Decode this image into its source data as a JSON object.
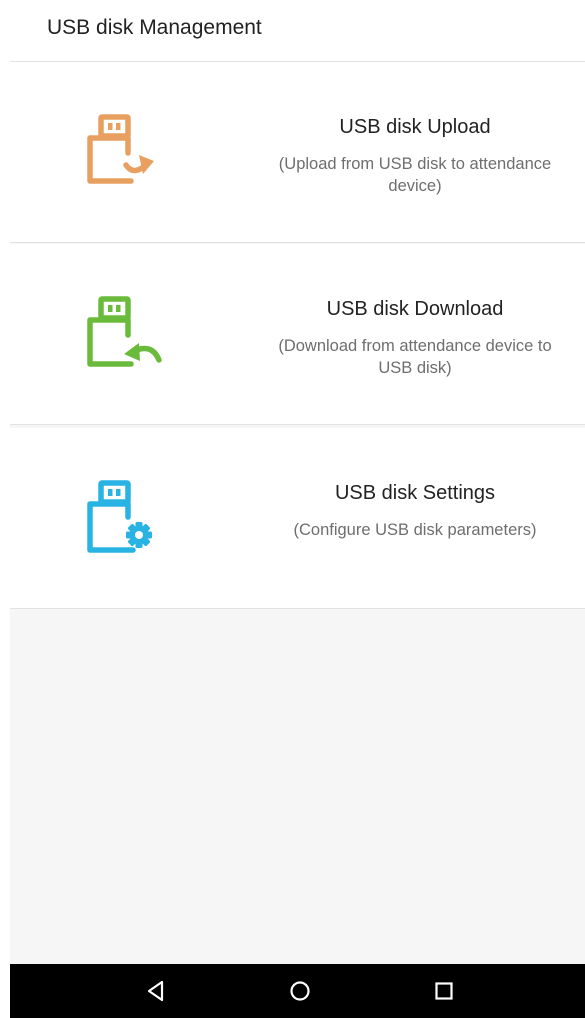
{
  "header": {
    "title": "USB disk Management"
  },
  "menu": {
    "items": [
      {
        "title": "USB disk Upload",
        "subtitle": "(Upload from USB disk to attendance device)",
        "icon": "usb-upload-icon",
        "color": "#e8a060"
      },
      {
        "title": "USB disk Download",
        "subtitle": "(Download from attendance device to USB disk)",
        "icon": "usb-download-icon",
        "color": "#6abb3c"
      },
      {
        "title": "USB disk Settings",
        "subtitle": "(Configure USB disk parameters)",
        "icon": "usb-settings-icon",
        "color": "#29b3e3"
      }
    ]
  },
  "navbar": {
    "buttons": [
      "back-icon",
      "home-icon",
      "recents-icon"
    ]
  }
}
